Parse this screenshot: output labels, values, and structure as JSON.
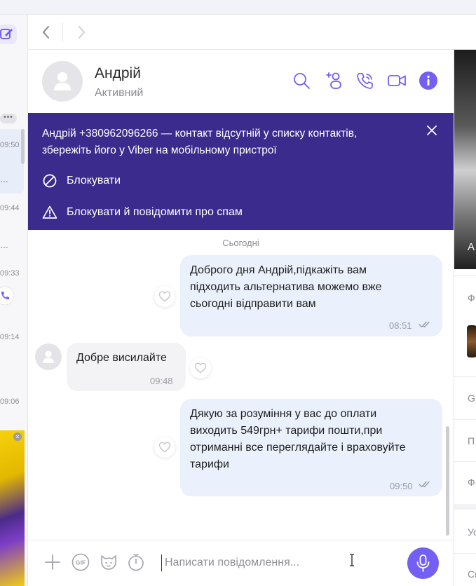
{
  "nav": {
    "back": "back",
    "forward": "forward"
  },
  "sidebar": {
    "times": [
      "09:50",
      "09:44",
      "09:33",
      "09:14",
      "09:06"
    ],
    "ellipses": [
      "…",
      "…"
    ],
    "dots": "•••",
    "ad_close": "×"
  },
  "header": {
    "name": "Андрій",
    "status": "Активний",
    "icons": [
      "search-icon",
      "add-participant-icon",
      "voice-call-icon",
      "video-call-icon",
      "info-icon"
    ]
  },
  "banner": {
    "text": "Андрій +380962096266 — контакт відсутній у списку контактів, збережіть його у Viber на мобільному пристрої",
    "block_label": "Блокувати",
    "block_report_label": "Блокувати й повідомити про спам"
  },
  "messages": {
    "date": "Сьогодні",
    "items": [
      {
        "direction": "out",
        "text_lines": [
          "Доброго дня Андрій,підкажіть вам",
          "підходить альтернатива можемо вже",
          "сьогодні відправити вам"
        ],
        "time": "08:51"
      },
      {
        "direction": "in",
        "text_lines": [
          "Добре висилайте"
        ],
        "time": "09:48"
      },
      {
        "direction": "out",
        "text_lines": [
          "Дякую за розуміння у вас до оплати",
          "виходить 549грн+ тарифи пошти,при",
          "отриманні все переглядайте і враховуйте",
          "тарифи"
        ],
        "time": "09:50"
      }
    ]
  },
  "input": {
    "placeholder": "Написати повідомлення...",
    "value": "",
    "icons": [
      "plus-icon",
      "gif-icon",
      "sticker-icon",
      "timer-icon",
      "microphone-icon"
    ],
    "gif_label": "GIF"
  },
  "right_panel": {
    "media_letter": "А",
    "items": [
      "Ф",
      "G",
      "П",
      "Ф",
      "Ус",
      "Сп"
    ]
  },
  "colors": {
    "accent": "#7360f2",
    "banner_bg": "#3b2b8c",
    "bubble_out": "#eaf0fc",
    "bubble_in": "#f3f3f5"
  }
}
